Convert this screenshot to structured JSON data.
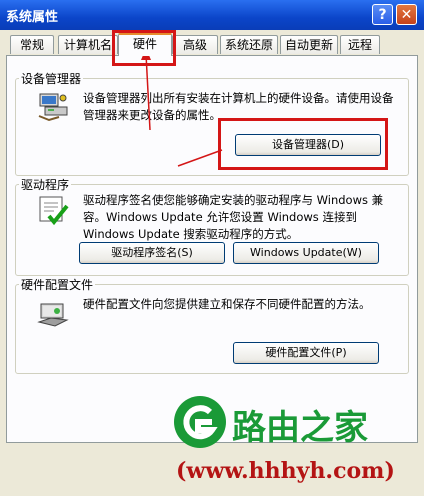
{
  "window": {
    "title": "系统属性",
    "help": "?",
    "close": "✕"
  },
  "tabs": [
    {
      "label": "常规"
    },
    {
      "label": "计算机名"
    },
    {
      "label": "硬件"
    },
    {
      "label": "高级"
    },
    {
      "label": "系统还原"
    },
    {
      "label": "自动更新"
    },
    {
      "label": "远程"
    }
  ],
  "device_manager": {
    "title": "设备管理器",
    "description": "设备管理器列出所有安装在计算机上的硬件设备。请使用设备管理器来更改设备的属性。",
    "button": "设备管理器(D)",
    "icon": "device-manager-icon"
  },
  "drivers": {
    "title": "驱动程序",
    "description": "驱动程序签名使您能够确定安装的驱动程序与 Windows 兼容。Windows Update 允许您设置 Windows 连接到 Windows Update 搜索驱动程序的方式。",
    "signing_button": "驱动程序签名(S)",
    "update_button": "Windows Update(W)",
    "icon": "driver-signing-icon"
  },
  "hardware_profiles": {
    "title": "硬件配置文件",
    "description": "硬件配置文件向您提供建立和保存不同硬件配置的方法。",
    "button": "硬件配置文件(P)",
    "icon": "hardware-profile-icon"
  },
  "watermark": {
    "brand": "路由之家",
    "url": "(www.hhhyh.com)"
  },
  "colors": {
    "annotation": "#d41616",
    "brand_green": "#1a9a37",
    "titlebar": "#0b45c9"
  }
}
